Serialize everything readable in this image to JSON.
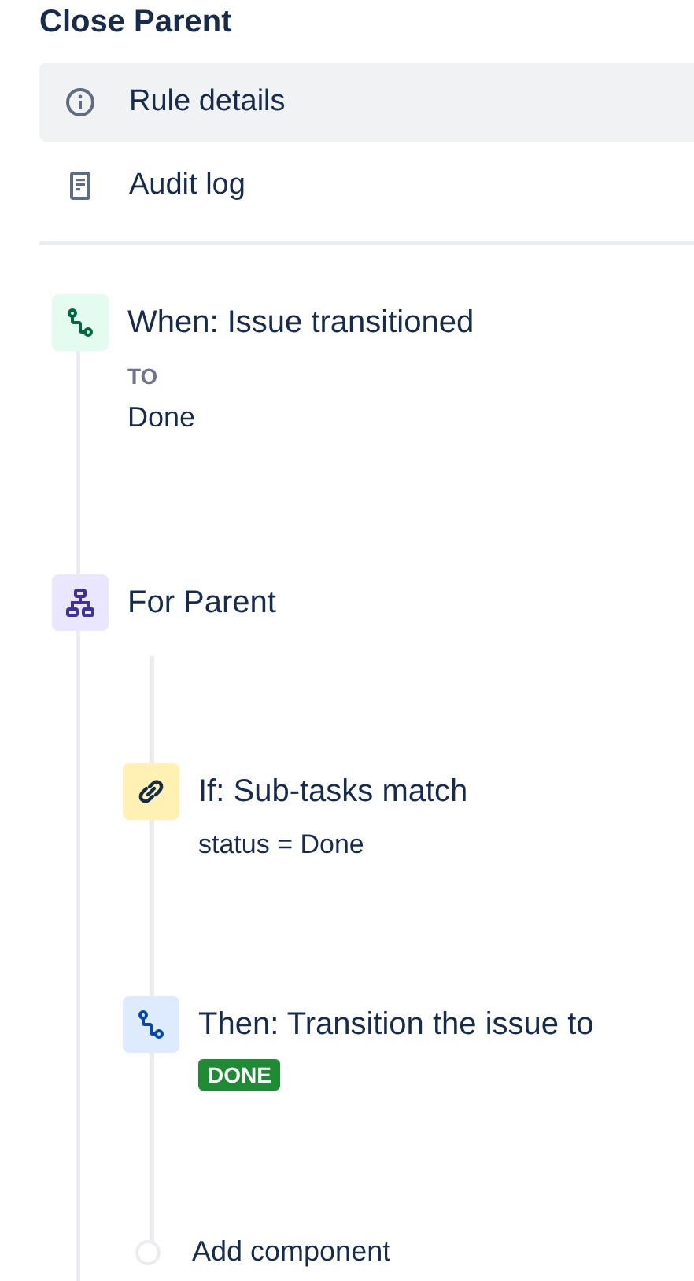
{
  "title": "Close Parent",
  "nav": [
    {
      "label": "Rule details",
      "selected": true
    },
    {
      "label": "Audit log",
      "selected": false
    }
  ],
  "steps": [
    {
      "kind": "trigger",
      "title": "When: Issue transitioned",
      "field_label": "TO",
      "detail": "Done"
    },
    {
      "kind": "branch",
      "title": "For Parent",
      "children": [
        {
          "kind": "condition",
          "title": "If: Sub-tasks match",
          "detail": "status = Done"
        },
        {
          "kind": "action",
          "title": "Then: Transition the issue to",
          "badge": "DONE"
        }
      ],
      "add_label": "Add component"
    }
  ]
}
